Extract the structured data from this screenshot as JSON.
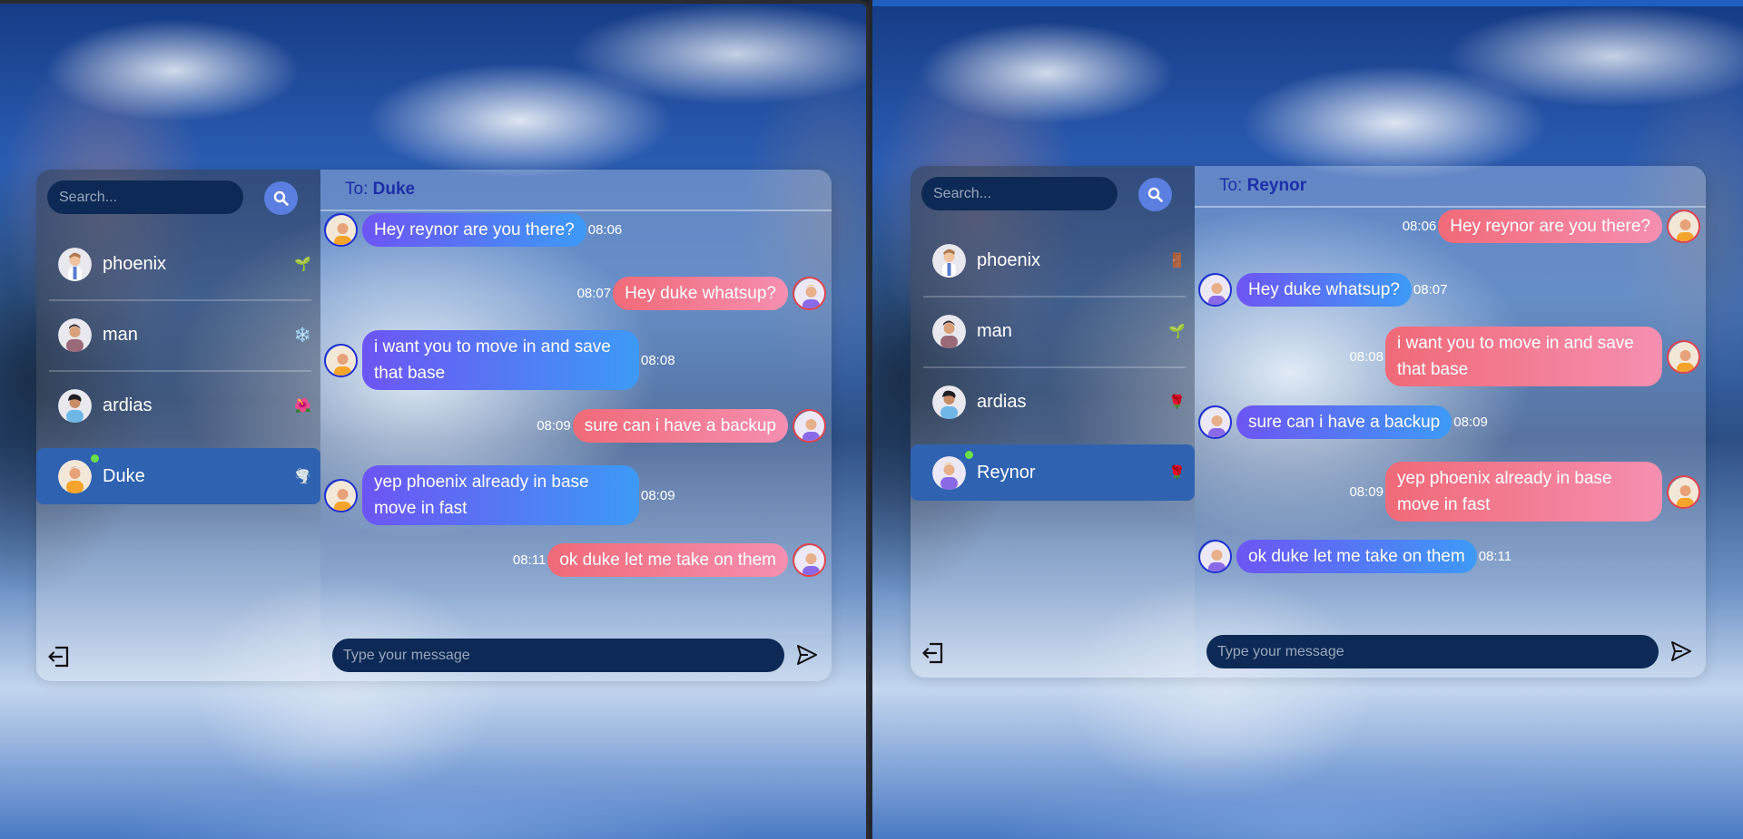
{
  "left": {
    "search": {
      "placeholder": "Search..."
    },
    "contacts": [
      {
        "name": "phoenix",
        "emoji": "🌱"
      },
      {
        "name": "man",
        "emoji": "❄️"
      },
      {
        "name": "ardias",
        "emoji": "🌺"
      },
      {
        "name": "Duke",
        "emoji": "🌪️",
        "active": true
      }
    ],
    "header": {
      "to_label": "To:",
      "recipient": "Duke"
    },
    "messages": [
      {
        "dir": "recv",
        "text": "Hey reynor are you there?",
        "time": "08:06"
      },
      {
        "dir": "sent",
        "text": "Hey duke whatsup?",
        "time": "08:07"
      },
      {
        "dir": "recv",
        "text": "i want you to move in and save that base",
        "time": "08:08"
      },
      {
        "dir": "sent",
        "text": "sure can i have a backup",
        "time": "08:09"
      },
      {
        "dir": "recv",
        "text": "yep phoenix already in base move in fast",
        "time": "08:09"
      },
      {
        "dir": "sent",
        "text": "ok duke let me take on them",
        "time": "08:11"
      }
    ],
    "composer": {
      "placeholder": "Type your message"
    }
  },
  "right": {
    "search": {
      "placeholder": "Search..."
    },
    "contacts": [
      {
        "name": "phoenix",
        "emoji": "🚪"
      },
      {
        "name": "man",
        "emoji": "🌱"
      },
      {
        "name": "ardias",
        "emoji": "🌹"
      },
      {
        "name": "Reynor",
        "emoji": "🌹",
        "active": true
      }
    ],
    "header": {
      "to_label": "To:",
      "recipient": "Reynor"
    },
    "messages": [
      {
        "dir": "sent",
        "text": "Hey reynor are you there?",
        "time": "08:06"
      },
      {
        "dir": "recv",
        "text": "Hey duke whatsup?",
        "time": "08:07"
      },
      {
        "dir": "sent",
        "text": "i want you to move in and save that base",
        "time": "08:08"
      },
      {
        "dir": "recv",
        "text": "sure can i have a backup",
        "time": "08:09"
      },
      {
        "dir": "sent",
        "text": "yep phoenix already in base move in fast",
        "time": "08:09"
      },
      {
        "dir": "recv",
        "text": "ok duke let me take on them",
        "time": "08:11"
      }
    ],
    "composer": {
      "placeholder": "Type your message"
    }
  },
  "icons": {
    "search": "search-icon",
    "logout": "logout-icon",
    "send": "send-icon"
  },
  "colors": {
    "accent": "#5b7fe0",
    "active_contact": "#2f62b0",
    "input_bg": "#0c2a55",
    "sent_bubble": "#f06a78",
    "recv_bubble": "#6d55f3"
  }
}
